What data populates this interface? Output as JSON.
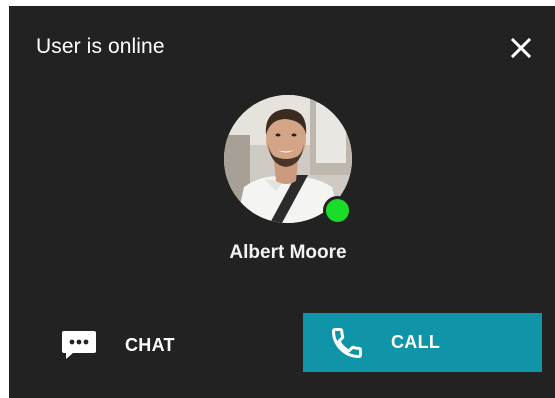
{
  "dialog": {
    "title": "User is online",
    "close_icon": "close-icon"
  },
  "user": {
    "name": "Albert Moore",
    "status": "online",
    "status_color": "#19dd2a",
    "avatar_icon": "avatar-photo"
  },
  "actions": {
    "chat_label": "CHAT",
    "chat_icon": "chat-bubble-icon",
    "call_label": "CALL",
    "call_icon": "phone-icon",
    "call_color": "#0f94a8"
  },
  "colors": {
    "background": "#222222",
    "text": "#ffffff"
  }
}
